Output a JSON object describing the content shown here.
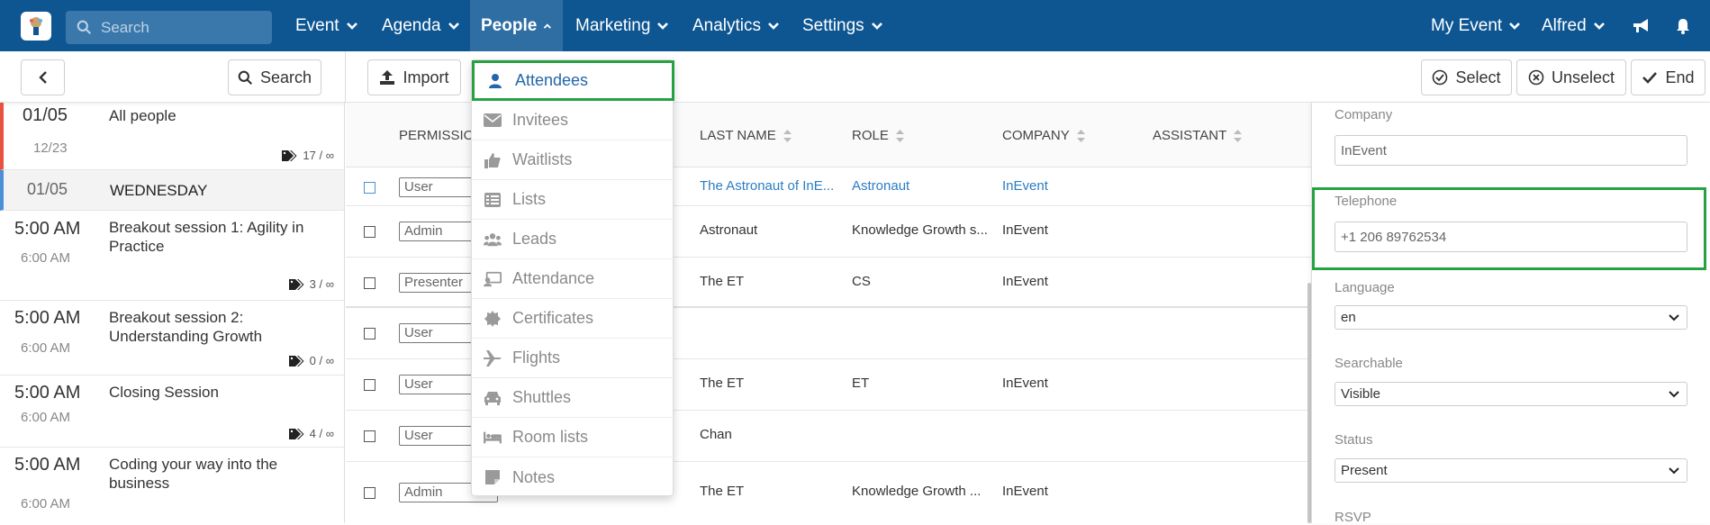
{
  "nav": {
    "search_placeholder": "Search",
    "items": [
      {
        "label": "Event"
      },
      {
        "label": "Agenda"
      },
      {
        "label": "People"
      },
      {
        "label": "Marketing"
      },
      {
        "label": "Analytics"
      },
      {
        "label": "Settings"
      }
    ],
    "right": [
      {
        "label": "My Event"
      },
      {
        "label": "Alfred"
      }
    ],
    "brand_color": "#0e5692"
  },
  "toolbar": {
    "search_label": "Search",
    "import_label": "Import",
    "select_label": "Select",
    "unselect_label": "Unselect",
    "end_label": "End"
  },
  "agenda": [
    {
      "time": "01/05",
      "end": "12/23",
      "title": "All people",
      "tag": "17 / ∞"
    },
    {
      "time": "01/05",
      "title": "WEDNESDAY"
    },
    {
      "time": "5:00 AM",
      "end": "6:00 AM",
      "title": "Breakout session 1: Agility in Practice",
      "tag": "3 / ∞"
    },
    {
      "time": "5:00 AM",
      "end": "6:00 AM",
      "title": "Breakout session 2: Understanding Growth",
      "tag": "0 / ∞"
    },
    {
      "time": "5:00 AM",
      "end": "6:00 AM",
      "title": "Closing Session",
      "tag": "4 / ∞"
    },
    {
      "time": "5:00 AM",
      "end": "6:00 AM",
      "title": "Coding your way into the business"
    }
  ],
  "table": {
    "headers": [
      "PERMISSIO",
      "LAST NAME",
      "ROLE",
      "COMPANY",
      "ASSISTANT"
    ],
    "rows": [
      {
        "permission": "User",
        "last_name": "The Astronaut of InE...",
        "role": "Astronaut",
        "company": "InEvent"
      },
      {
        "permission": "Admin",
        "last_name": "Astronaut",
        "role": "Knowledge Growth s...",
        "company": "InEvent"
      },
      {
        "permission": "Presenter",
        "last_name": "The ET",
        "role": "CS",
        "company": "InEvent"
      },
      {
        "permission": "User",
        "last_name": "",
        "role": "",
        "company": ""
      },
      {
        "permission": "User",
        "last_name": "The ET",
        "role": "ET",
        "company": "InEvent"
      },
      {
        "permission": "User",
        "last_name": "Chan",
        "role": "",
        "company": ""
      },
      {
        "permission": "Admin",
        "last_name": "The ET",
        "role": "Knowledge Growth ...",
        "company": "InEvent"
      }
    ]
  },
  "dropdown": {
    "items": [
      {
        "label": "Attendees",
        "icon": "user-icon"
      },
      {
        "label": "Invitees",
        "icon": "envelope-icon"
      },
      {
        "label": "Waitlists",
        "icon": "thumbs-up-icon"
      },
      {
        "label": "Lists",
        "icon": "list-icon"
      },
      {
        "label": "Leads",
        "icon": "users-icon"
      },
      {
        "label": "Attendance",
        "icon": "attendance-icon"
      },
      {
        "label": "Certificates",
        "icon": "certificate-icon"
      },
      {
        "label": "Flights",
        "icon": "plane-icon"
      },
      {
        "label": "Shuttles",
        "icon": "car-icon"
      },
      {
        "label": "Room lists",
        "icon": "bed-icon"
      },
      {
        "label": "Notes",
        "icon": "note-icon"
      }
    ]
  },
  "panel": {
    "company_label": "Company",
    "company_value": "InEvent",
    "telephone_label": "Telephone",
    "telephone_value": "+1 206 89762534",
    "language_label": "Language",
    "language_value": "en",
    "searchable_label": "Searchable",
    "searchable_value": "Visible",
    "status_label": "Status",
    "status_value": "Present",
    "rsvp_label": "RSVP"
  }
}
